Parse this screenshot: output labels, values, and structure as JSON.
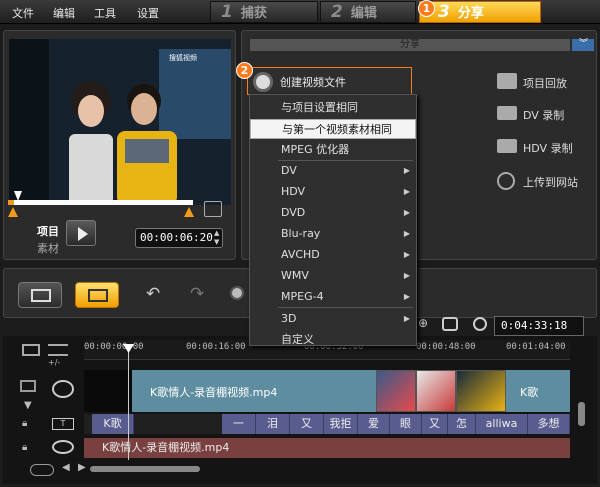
{
  "menu": {
    "file": "文件",
    "edit": "编辑",
    "tools": "工具",
    "settings": "设置"
  },
  "steps": [
    {
      "num": "1",
      "label": "捕获"
    },
    {
      "num": "2",
      "label": "编辑"
    },
    {
      "num": "3",
      "label": "分享"
    }
  ],
  "badges": {
    "one": "1",
    "two": "2"
  },
  "preview": {
    "video_watermark": "搜狐视频",
    "project_label": "项目",
    "clip_label": "素材",
    "timecode": "00:00:06:20",
    "scrub_progress": 0.03
  },
  "share": {
    "header": "分享",
    "create_video_label": "创建视频文件",
    "side_options": [
      {
        "label": "项目回放",
        "icon": "film-play-icon"
      },
      {
        "label": "DV 录制",
        "icon": "camcorder-icon"
      },
      {
        "label": "HDV 录制",
        "icon": "camcorder-icon"
      },
      {
        "label": "上传到网站",
        "icon": "globe-icon"
      }
    ]
  },
  "dropdown": {
    "items": [
      {
        "label": "与项目设置相同",
        "submenu": false,
        "highlighted": false
      },
      {
        "label": "与第一个视频素材相同",
        "submenu": false,
        "highlighted": true
      },
      {
        "label": "MPEG 优化器",
        "submenu": false,
        "highlighted": false
      },
      {
        "label": "DV",
        "submenu": true,
        "highlighted": false
      },
      {
        "label": "HDV",
        "submenu": true,
        "highlighted": false
      },
      {
        "label": "DVD",
        "submenu": true,
        "highlighted": false
      },
      {
        "label": "Blu-ray",
        "submenu": true,
        "highlighted": false
      },
      {
        "label": "AVCHD",
        "submenu": true,
        "highlighted": false
      },
      {
        "label": "WMV",
        "submenu": true,
        "highlighted": false
      },
      {
        "label": "MPEG-4",
        "submenu": true,
        "highlighted": false
      },
      {
        "label": "3D",
        "submenu": true,
        "highlighted": false
      },
      {
        "label": "自定义",
        "submenu": false,
        "highlighted": false
      }
    ]
  },
  "timeline": {
    "zoom_time": "0:04:33:18",
    "ruler_labels": [
      "00:00:00:00",
      "00:00:16:00",
      "00:00:32:00",
      "00:00:48:00",
      "00:01:04:00"
    ],
    "video_clip_name": "K歌情人-录音棚视频.mp4",
    "video_clip_name_2": "K歌",
    "title_clips": [
      "K歌",
      "一",
      "泪",
      "又",
      "我拒",
      "爱",
      "眼",
      "又",
      "怎",
      "alliwa",
      "多想"
    ],
    "audio_clip_name": "K歌情人-录音棚视频.mp4",
    "add_label": "+/-"
  },
  "colors": {
    "accent": "#f0a000",
    "highlight_border": "#ff7a1a",
    "video_track": "#5e8da0",
    "title_track": "#585c8e",
    "audio_track": "#7a3f3f"
  }
}
